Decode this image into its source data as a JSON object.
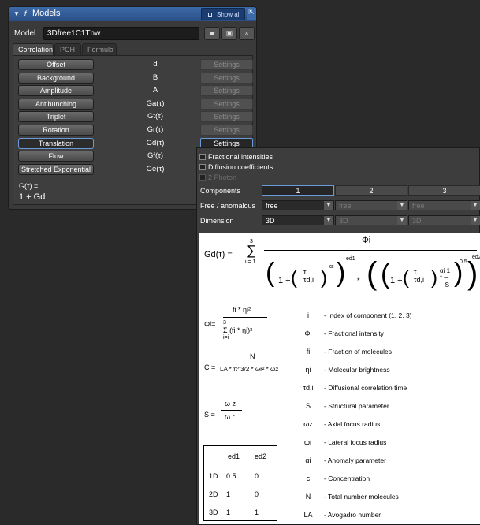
{
  "panel": {
    "title": "Models",
    "show_all": "Show all",
    "model_label": "Model",
    "model_name": "3Dfree1C1Tnw",
    "tabs": [
      "Correlation",
      "PCH",
      "Formula"
    ],
    "components": [
      {
        "label": "Offset",
        "symbol": "d",
        "settings": "Settings",
        "selected": false,
        "settings_active": false
      },
      {
        "label": "Background",
        "symbol": "B",
        "settings": "Settings",
        "selected": false,
        "settings_active": false
      },
      {
        "label": "Amplitude",
        "symbol": "A",
        "settings": "Settings",
        "selected": false,
        "settings_active": false
      },
      {
        "label": "Antibunching",
        "symbol": "Ga(τ)",
        "settings": "Settings",
        "selected": false,
        "settings_active": false
      },
      {
        "label": "Triplet",
        "symbol": "Gt(τ)",
        "settings": "Settings",
        "selected": false,
        "settings_active": false
      },
      {
        "label": "Rotation",
        "symbol": "Gr(τ)",
        "settings": "Settings",
        "selected": false,
        "settings_active": false
      },
      {
        "label": "Translation",
        "symbol": "Gd(τ)",
        "settings": "Settings",
        "selected": true,
        "settings_active": true
      },
      {
        "label": "Flow",
        "symbol": "Gf(τ)",
        "settings": "Settings",
        "selected": false,
        "settings_active": false
      },
      {
        "label": "Stretched Exponential",
        "symbol": "Ge(τ)",
        "settings": "Settings",
        "selected": false,
        "settings_active": false
      }
    ],
    "gtau_label": "G(τ) =",
    "gtau_value": "1 + Gd"
  },
  "settings_popup": {
    "checkboxes": [
      {
        "label": "Fractional intensities",
        "checked": false,
        "enabled": true
      },
      {
        "label": "Diffusion coefficients",
        "checked": false,
        "enabled": true
      },
      {
        "label": "2 Photon",
        "checked": false,
        "enabled": false
      }
    ],
    "components_label": "Components",
    "component_columns": [
      "1",
      "2",
      "3"
    ],
    "free_label": "Free / anomalous",
    "free_values": [
      "free",
      "free",
      "free"
    ],
    "dimension_label": "Dimension",
    "dimension_values": [
      "3D",
      "3D",
      "3D"
    ],
    "formula": {
      "gd_lhs": "Gd(τ) =",
      "sum_top": "3",
      "sum_bottom": "i = 1",
      "phi_num": "Φi",
      "phi_lhs": "Φi=",
      "phi_numerator": "fi * ηi²",
      "phi_denominator": "Σ (fi * ηi)²",
      "phi_sum_top": "3",
      "phi_sum_bottom": "i=i",
      "c_lhs": "C =",
      "c_num": "N",
      "c_den": "LA * π^3/2 * ωr² * ωz",
      "s_lhs": "S =",
      "s_num": "ω z",
      "s_den": "ω r",
      "exp_d1": "ed1",
      "exp_d2": "ed2",
      "half": "0.5"
    },
    "legend": [
      {
        "symbol": "i",
        "desc": "- Index of component (1, 2, 3)"
      },
      {
        "symbol": "Φi",
        "desc": "- Fractional intensity"
      },
      {
        "symbol": "fi",
        "desc": "- Fraction of molecules"
      },
      {
        "symbol": "ηi",
        "desc": "- Molecular brightness"
      },
      {
        "symbol": "τd,i",
        "desc": "- Diffusional correlation time"
      },
      {
        "symbol": "S",
        "desc": "- Structural parameter"
      },
      {
        "symbol": "ωz",
        "desc": "- Axial focus radius"
      },
      {
        "symbol": "ωr",
        "desc": "- Lateral focus radius"
      },
      {
        "symbol": "αi",
        "desc": "- Anomaly parameter"
      },
      {
        "symbol": "c",
        "desc": "- Concentration"
      },
      {
        "symbol": "N",
        "desc": "- Total number molecules"
      },
      {
        "symbol": "LA",
        "desc": "- Avogadro number"
      }
    ],
    "exp_table": {
      "headers": [
        "ed1",
        "ed2"
      ],
      "rows": [
        {
          "dim": "1D",
          "ed1": "0.5",
          "ed2": "0"
        },
        {
          "dim": "2D",
          "ed1": "1",
          "ed2": "0"
        },
        {
          "dim": "3D",
          "ed1": "1",
          "ed2": "1"
        }
      ]
    }
  }
}
